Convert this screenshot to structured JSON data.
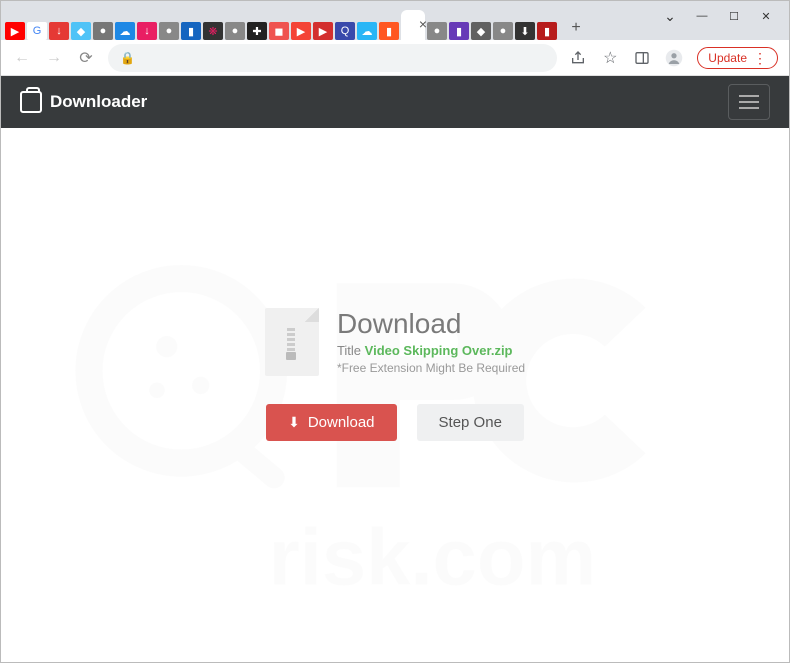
{
  "window": {
    "update_label": "Update"
  },
  "tabs": {
    "favicons": [
      {
        "bg": "#ff0000",
        "fg": "#fff",
        "char": "▶"
      },
      {
        "bg": "#fff",
        "fg": "#4285f4",
        "char": "G"
      },
      {
        "bg": "#e53935",
        "fg": "#fff",
        "char": "↓"
      },
      {
        "bg": "#4fc3f7",
        "fg": "#fff",
        "char": "◆"
      },
      {
        "bg": "#777",
        "fg": "#fff",
        "char": "●"
      },
      {
        "bg": "#1e88e5",
        "fg": "#fff",
        "char": "☁"
      },
      {
        "bg": "#e91e63",
        "fg": "#fff",
        "char": "↓"
      },
      {
        "bg": "#888",
        "fg": "#fff",
        "char": "●"
      },
      {
        "bg": "#1565c0",
        "fg": "#fff",
        "char": "▮"
      },
      {
        "bg": "#333",
        "fg": "#e91e63",
        "char": "❋"
      },
      {
        "bg": "#888",
        "fg": "#fff",
        "char": "●"
      },
      {
        "bg": "#222",
        "fg": "#fff",
        "char": "✚"
      },
      {
        "bg": "#ef5350",
        "fg": "#fff",
        "char": "◼"
      },
      {
        "bg": "#f44336",
        "fg": "#fff",
        "char": "▶"
      },
      {
        "bg": "#d32f2f",
        "fg": "#fff",
        "char": "▶"
      },
      {
        "bg": "#3949ab",
        "fg": "#fff",
        "char": "Q"
      },
      {
        "bg": "#29b6f6",
        "fg": "#fff",
        "char": "☁"
      },
      {
        "bg": "#ff5722",
        "fg": "#fff",
        "char": "▮"
      },
      {
        "bg": "#fff",
        "fg": "#333",
        "char": " ",
        "active": true
      },
      {
        "bg": "#888",
        "fg": "#fff",
        "char": "●"
      },
      {
        "bg": "#673ab7",
        "fg": "#fff",
        "char": "▮"
      },
      {
        "bg": "#616161",
        "fg": "#fff",
        "char": "◆"
      },
      {
        "bg": "#888",
        "fg": "#fff",
        "char": "●"
      },
      {
        "bg": "#333",
        "fg": "#fff",
        "char": "⬇"
      },
      {
        "bg": "#b71c1c",
        "fg": "#fff",
        "char": "▮"
      }
    ]
  },
  "page": {
    "brand": "Downloader",
    "download_heading": "Download",
    "title_label": "Title ",
    "filename": "Video Skipping Over.zip",
    "note": "*Free Extension Might Be Required",
    "download_button": "Download",
    "step_button": "Step One"
  }
}
